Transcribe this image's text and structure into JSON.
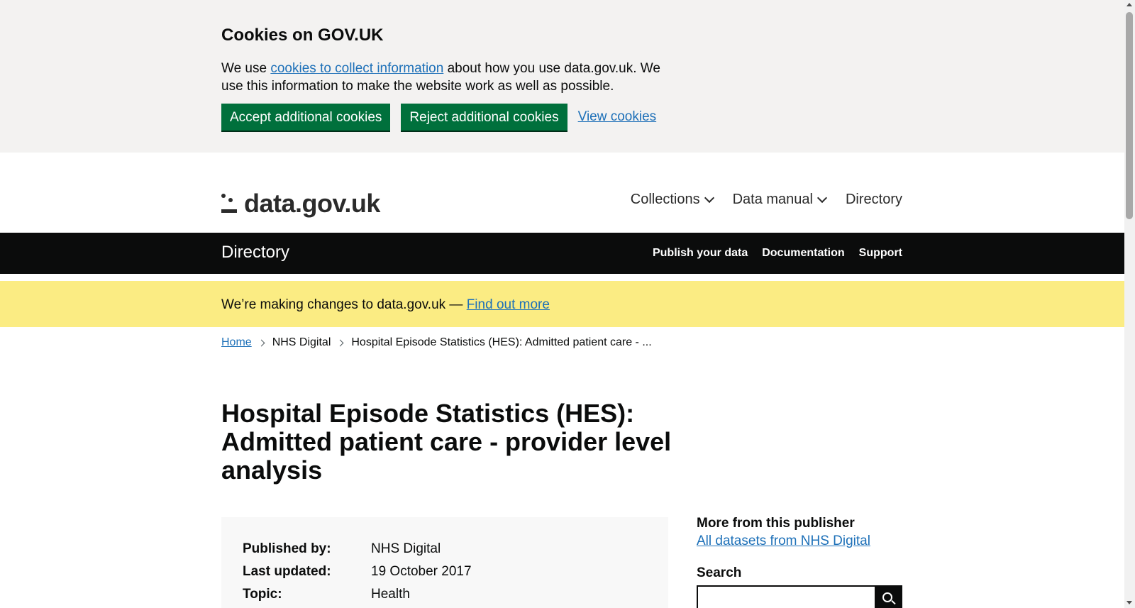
{
  "cookie_banner": {
    "title": "Cookies on GOV.UK",
    "text_before": "We use ",
    "text_link": "cookies to collect information",
    "text_after": " about how you use data.gov.uk. We use this information to make the website work as well as possible.",
    "accept_label": "Accept additional cookies",
    "reject_label": "Reject additional cookies",
    "view_label": "View cookies"
  },
  "header": {
    "logo_text": "data.gov.uk",
    "nav": [
      {
        "label": "Collections"
      },
      {
        "label": "Data manual"
      },
      {
        "label": "Directory"
      }
    ]
  },
  "section_bar": {
    "title": "Directory",
    "links": [
      "Publish your data",
      "Documentation",
      "Support"
    ]
  },
  "notice": {
    "text": "We’re making changes to data.gov.uk — ",
    "link": "Find out more"
  },
  "breadcrumb": [
    "Home",
    "NHS Digital",
    "Hospital Episode Statistics (HES): Admitted patient care - ..."
  ],
  "page_title": "Hospital Episode Statistics (HES): Admitted patient care - provider level analysis",
  "summary": {
    "rows": [
      {
        "label": "Published by:",
        "value": "NHS Digital"
      },
      {
        "label": "Last updated:",
        "value": "19 October 2017"
      },
      {
        "label": "Topic:",
        "value": "Health"
      }
    ]
  },
  "sidebar": {
    "more_heading": "More from this publisher",
    "more_link": "All datasets from NHS Digital",
    "search_heading": "Search",
    "search_value": ""
  },
  "colors": {
    "accent_green": "#00703c",
    "link_blue": "#1d70b8",
    "notice_yellow": "#fbec83",
    "bar_black": "#0b0c0c"
  }
}
